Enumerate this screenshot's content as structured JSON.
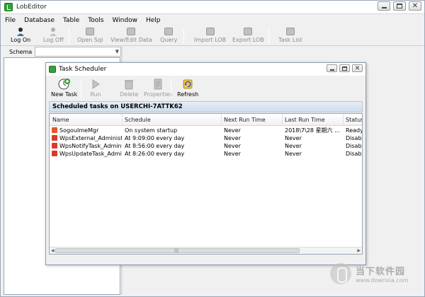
{
  "app": {
    "title": "LobEditor"
  },
  "menubar": {
    "items": [
      "File",
      "Database",
      "Table",
      "Tools",
      "Window",
      "Help"
    ]
  },
  "toolbar": {
    "buttons": [
      {
        "label": "Log On",
        "icon": "user-icon",
        "enabled": true
      },
      {
        "label": "Log Off",
        "icon": "user-off-icon",
        "enabled": false
      },
      {
        "label": "Open Sql",
        "icon": "open-sql-icon",
        "enabled": false
      },
      {
        "label": "View/Edit Data",
        "icon": "edit-data-icon",
        "enabled": false
      },
      {
        "label": "Query",
        "icon": "query-icon",
        "enabled": false
      },
      {
        "label": "Import LOB",
        "icon": "import-icon",
        "enabled": false
      },
      {
        "label": "Export LOB",
        "icon": "export-icon",
        "enabled": false
      },
      {
        "label": "Task List",
        "icon": "task-list-icon",
        "enabled": false
      }
    ]
  },
  "left_pane": {
    "schema_label": "Schema",
    "schema_value": ""
  },
  "task_scheduler": {
    "title": "Task Scheduler",
    "toolbar": {
      "new_task": "New Task",
      "run": "Run",
      "delete": "Delete",
      "properties": "Properties",
      "refresh": "Refresh"
    },
    "header": "Scheduled tasks on USERCHI-7ATTK62",
    "columns": [
      "Name",
      "Schedule",
      "Next Run Time",
      "Last Run Time",
      "Status"
    ],
    "rows": [
      {
        "name": "SogouImeMgr",
        "schedule": "On system startup",
        "next": "Never",
        "last": "2018\\7\\28 星期六 ...",
        "status": "Ready",
        "icon_color": "#e8542c"
      },
      {
        "name": "WpsExternal_Administ...",
        "schedule": "At 9:09:00 every day",
        "next": "Never",
        "last": "Never",
        "status": "Disable",
        "icon_color": "#d93b2b"
      },
      {
        "name": "WpsNotifyTask_Admini...",
        "schedule": "At 8:56:00 every day",
        "next": "Never",
        "last": "Never",
        "status": "Disable",
        "icon_color": "#d93b2b"
      },
      {
        "name": "WpsUpdateTask_Admi...",
        "schedule": "At 8:26:00 every day",
        "next": "Never",
        "last": "Never",
        "status": "Disable",
        "icon_color": "#d93b2b"
      }
    ],
    "scrollbar_grip": "|||"
  },
  "watermark": {
    "text": "当下软件园",
    "url": "www.downxia.com"
  },
  "colors": {
    "accent_green": "#35a33a",
    "header_bar": "#cfdceb",
    "disabled_text": "#999999"
  }
}
